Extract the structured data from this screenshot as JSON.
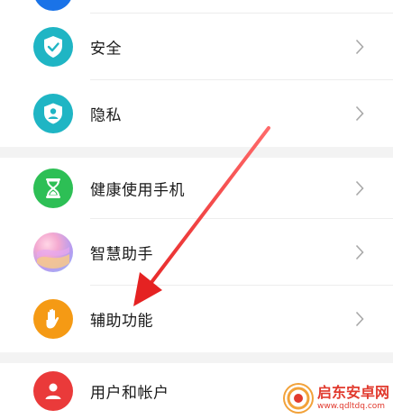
{
  "settings": {
    "group1": [
      {
        "label": "安全",
        "icon": "shield-check-icon",
        "color": "#1fb5c4"
      },
      {
        "label": "隐私",
        "icon": "privacy-person-icon",
        "color": "#1fb5c4"
      }
    ],
    "group2": [
      {
        "label": "健康使用手机",
        "icon": "hourglass-icon",
        "color": "#2dbf55"
      },
      {
        "label": "智慧助手",
        "icon": "smart-assistant-icon",
        "color": "#b890e8"
      },
      {
        "label": "辅助功能",
        "icon": "hand-icon",
        "color": "#f59a14"
      }
    ],
    "group3": [
      {
        "label": "用户和帐户",
        "icon": "user-icon",
        "color": "#ea3a3a"
      }
    ]
  },
  "watermark": {
    "name": "启东安卓网",
    "url": "www.qdltdq.com"
  }
}
